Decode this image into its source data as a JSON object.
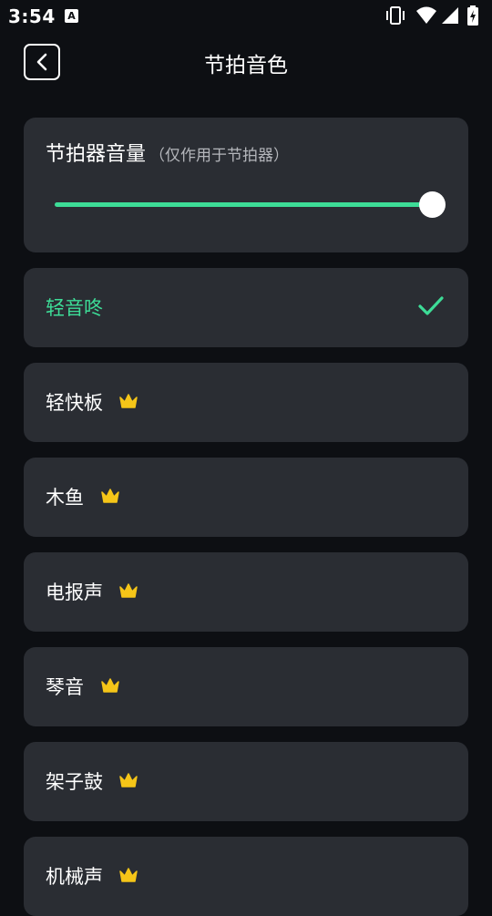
{
  "status_bar": {
    "time": "3:54",
    "a_badge": "A",
    "icons": [
      "vibrate-icon",
      "wifi-icon",
      "signal-icon",
      "battery-icon"
    ]
  },
  "header": {
    "back_icon": "chevron-left-icon",
    "title": "节拍音色"
  },
  "volume": {
    "title": "节拍器音量",
    "note": "（仅作用于节拍器）",
    "level": 1.0,
    "accent_color": "#3ddc97"
  },
  "sounds": [
    {
      "label": "轻音咚",
      "selected": true,
      "premium": false
    },
    {
      "label": "轻快板",
      "selected": false,
      "premium": true
    },
    {
      "label": "木鱼",
      "selected": false,
      "premium": true
    },
    {
      "label": "电报声",
      "selected": false,
      "premium": true
    },
    {
      "label": "琴音",
      "selected": false,
      "premium": true
    },
    {
      "label": "架子鼓",
      "selected": false,
      "premium": true
    },
    {
      "label": "机械声",
      "selected": false,
      "premium": true
    }
  ],
  "colors": {
    "background": "#0d0f13",
    "card": "#2a2d33",
    "accent": "#3ddc97",
    "crown": "#f5c518"
  }
}
